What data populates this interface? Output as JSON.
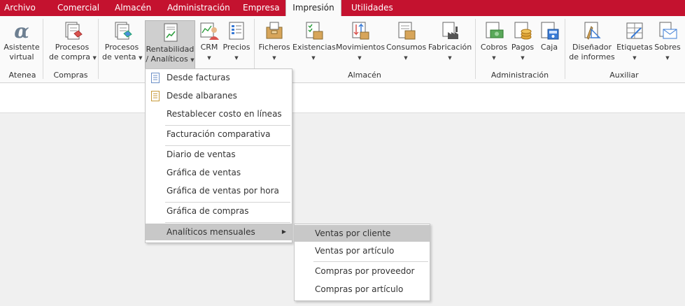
{
  "menubar": {
    "tabs": [
      {
        "label": "Archivo"
      },
      {
        "label": "Comercial"
      },
      {
        "label": "Almacén"
      },
      {
        "label": "Administración"
      },
      {
        "label": "Empresa"
      },
      {
        "label": "Impresión",
        "active": true
      },
      {
        "label": "Utilidades"
      }
    ]
  },
  "ribbon": {
    "buttons": [
      {
        "line1": "Asistente",
        "line2": "virtual",
        "icon": "alpha-icon"
      },
      {
        "line1": "Procesos",
        "line2": "de compra",
        "icon": "purchase-doc-icon"
      },
      {
        "line1": "Procesos",
        "line2": "de venta",
        "icon": "sales-doc-icon"
      },
      {
        "line1": "Rentabilidad",
        "line2": "/ Analíticos",
        "icon": "chart-doc-icon"
      },
      {
        "line1": "CRM",
        "icon": "crm-icon"
      },
      {
        "line1": "Precios",
        "icon": "price-list-icon"
      },
      {
        "line1": "Ficheros",
        "icon": "files-box-icon"
      },
      {
        "line1": "Existencias",
        "icon": "stock-check-icon"
      },
      {
        "line1": "Movimientos",
        "icon": "movements-icon"
      },
      {
        "line1": "Consumos",
        "icon": "consumption-icon"
      },
      {
        "line1": "Fabricación",
        "icon": "factory-icon"
      },
      {
        "line1": "Cobros",
        "icon": "money-in-icon"
      },
      {
        "line1": "Pagos",
        "icon": "coins-icon"
      },
      {
        "line1": "Caja",
        "icon": "cash-register-icon"
      },
      {
        "line1": "Diseñador",
        "line2": "de informes",
        "icon": "report-designer-icon"
      },
      {
        "line1": "Etiquetas",
        "icon": "labels-icon"
      },
      {
        "line1": "Sobres",
        "icon": "envelope-icon"
      }
    ],
    "groups": [
      "Atenea",
      "Compras",
      "Almacén",
      "Administración",
      "Auxiliar"
    ]
  },
  "dropdown": {
    "items": [
      {
        "label": "Desde facturas",
        "icon": "document-blue-icon"
      },
      {
        "label": "Desde albaranes",
        "icon": "document-yellow-icon"
      },
      {
        "label": "Restablecer costo en líneas"
      },
      {
        "label": "Facturación comparativa"
      },
      {
        "label": "Diario de ventas"
      },
      {
        "label": "Gráfica de ventas"
      },
      {
        "label": "Gráfica de ventas por hora"
      },
      {
        "label": "Gráfica de compras"
      },
      {
        "label": "Analíticos mensuales",
        "submenu": true
      }
    ]
  },
  "submenu": {
    "items": [
      {
        "label": "Ventas por cliente"
      },
      {
        "label": "Ventas por artículo"
      },
      {
        "label": "Compras por proveedor"
      },
      {
        "label": "Compras por artículo"
      }
    ]
  },
  "colors": {
    "brand": "#c4122f",
    "ribbon_bg": "#fafafa",
    "workspace": "#f0f0f0",
    "highlight": "#c8c8c8"
  }
}
